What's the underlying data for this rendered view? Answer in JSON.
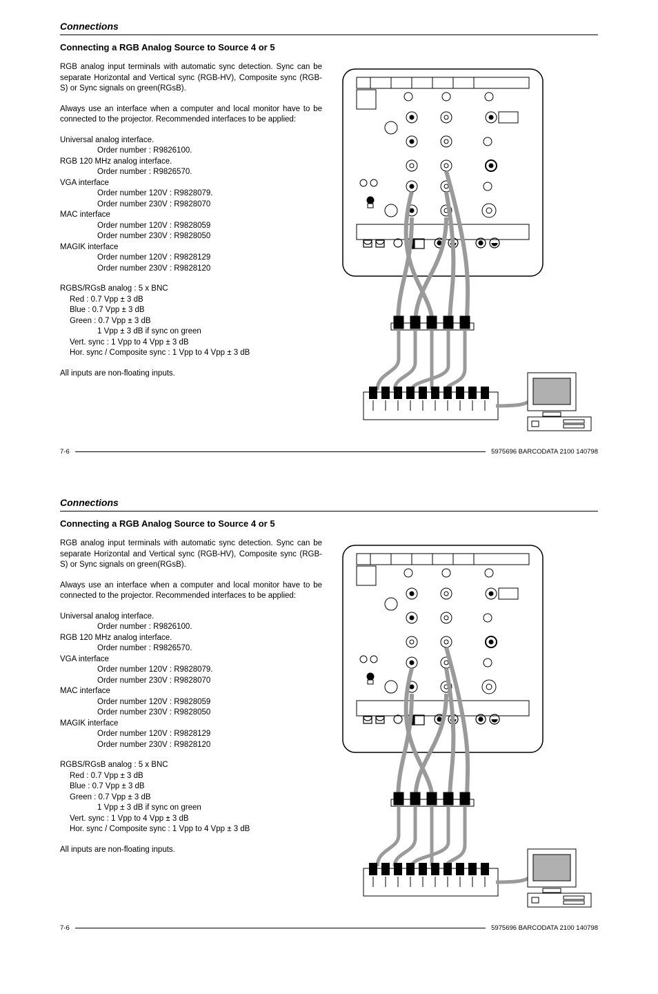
{
  "section_header": "Connections",
  "title": "Connecting a RGB Analog Source to Source 4 or 5",
  "para1": "RGB analog input terminals with automatic sync detection.  Sync can be separate Horizontal and Vertical sync (RGB-HV),  Composite sync (RGB-S) or Sync signals on green(RGsB).",
  "para2": "Always use an interface when a computer and local monitor have to be connected to the projector.   Recommended interfaces to be applied:",
  "interfaces": {
    "universal": {
      "name": "Universal analog interface.",
      "order": "Order number : R9826100."
    },
    "rgb120": {
      "name": "RGB 120 MHz analog interface.",
      "order": "Order number : R9826570."
    },
    "vga": {
      "name": "VGA  interface",
      "order1": "Order number 120V : R9828079.",
      "order2": "Order number 230V : R9828070"
    },
    "mac": {
      "name": "MAC interface",
      "order1": "Order number 120V : R9828059",
      "order2": "Order number 230V : R9828050"
    },
    "magik": {
      "name": "MAGIK interface",
      "order1": "Order number 120V : R9828129",
      "order2": "Order number 230V : R9828120"
    }
  },
  "signals": {
    "header": "RGBS/RGsB analog : 5 x BNC",
    "red": "Red : 0.7 Vpp ± 3 dB",
    "blue": "Blue : 0.7 Vpp ± 3 dB",
    "green": "Green : 0.7 Vpp ± 3 dB",
    "green_sync": "1 Vpp ± 3 dB if sync on green",
    "vsync": "Vert. sync : 1 Vpp to 4 Vpp ± 3 dB",
    "hsync": "Hor. sync / Composite sync : 1 Vpp to 4 Vpp ± 3 dB"
  },
  "note_inputs": "All inputs are non-floating inputs.",
  "footer": {
    "page": "7-6",
    "docid": "5975696 BARCODATA 2100 140798"
  }
}
